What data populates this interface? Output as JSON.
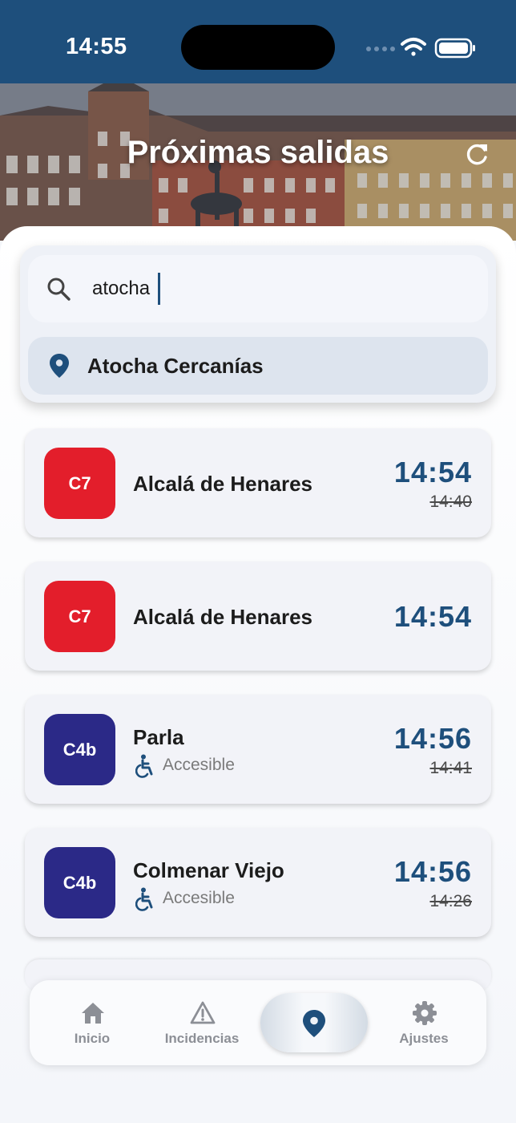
{
  "status_bar": {
    "time": "14:55"
  },
  "header": {
    "title": "Próximas salidas"
  },
  "search": {
    "query": "atocha",
    "suggestion": "Atocha Cercanías"
  },
  "departures": [
    {
      "line": "C7",
      "line_color": "#e31e2b",
      "destination": "Alcalá de Henares",
      "time": "14:54",
      "scheduled": "14:40",
      "accessible": ""
    },
    {
      "line": "C7",
      "line_color": "#e31e2b",
      "destination": "Alcalá de Henares",
      "time": "14:54",
      "scheduled": "",
      "accessible": ""
    },
    {
      "line": "C4b",
      "line_color": "#2b2987",
      "destination": "Parla",
      "time": "14:56",
      "scheduled": "14:41",
      "accessible": "Accesible"
    },
    {
      "line": "C4b",
      "line_color": "#2b2987",
      "destination": "Colmenar Viejo",
      "time": "14:56",
      "scheduled": "14:26",
      "accessible": "Accesible"
    }
  ],
  "nav": {
    "inicio": "Inicio",
    "incidencias": "Incidencias",
    "ajustes": "Ajustes"
  },
  "colors": {
    "primary": "#1e4f7c",
    "nav_inactive": "#8c8f96"
  }
}
